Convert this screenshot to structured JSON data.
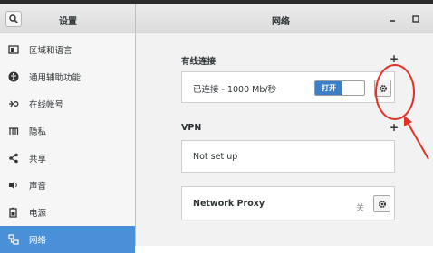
{
  "sidebar": {
    "title": "设置",
    "items": [
      {
        "label": "区域和语言",
        "icon": "region-icon"
      },
      {
        "label": "通用辅助功能",
        "icon": "accessibility-icon"
      },
      {
        "label": "在线帐号",
        "icon": "online-accounts-icon"
      },
      {
        "label": "隐私",
        "icon": "privacy-icon"
      },
      {
        "label": "共享",
        "icon": "share-icon"
      },
      {
        "label": "声音",
        "icon": "sound-icon"
      },
      {
        "label": "电源",
        "icon": "power-icon"
      },
      {
        "label": "网络",
        "icon": "network-icon",
        "active": true
      }
    ]
  },
  "main": {
    "title": "网络",
    "wired": {
      "section_label": "有线连接",
      "status": "已连接 - 1000 Mb/秒",
      "toggle_label": "打开",
      "toggle_on": true
    },
    "vpn": {
      "section_label": "VPN",
      "status": "Not set up"
    },
    "proxy": {
      "label": "Network Proxy",
      "state": "关"
    }
  },
  "colors": {
    "accent": "#4a90d9",
    "annotation": "#e0342a"
  }
}
